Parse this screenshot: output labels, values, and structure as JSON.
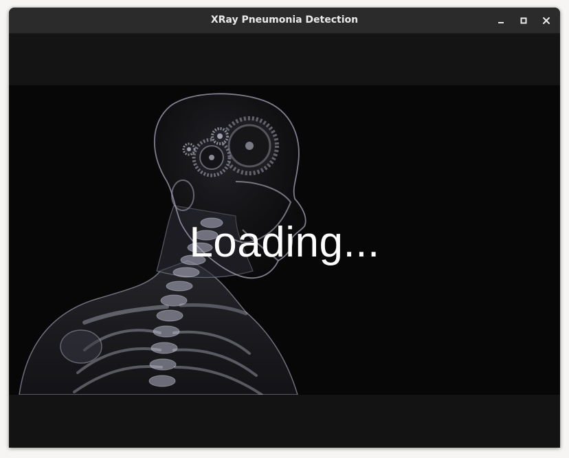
{
  "window": {
    "title": "XRay Pneumonia Detection",
    "controls": {
      "minimize_icon": "minimize-icon",
      "maximize_icon": "maximize-icon",
      "close_icon": "close-icon"
    }
  },
  "splash": {
    "status_text": "Loading...",
    "image": "xray-skeleton-head-gears"
  },
  "colors": {
    "titlebar": "#2b2b2b",
    "title_text": "#ebebeb",
    "window_bg": "#141414",
    "stage_bg": "#070707",
    "status_text": "#ffffff"
  }
}
